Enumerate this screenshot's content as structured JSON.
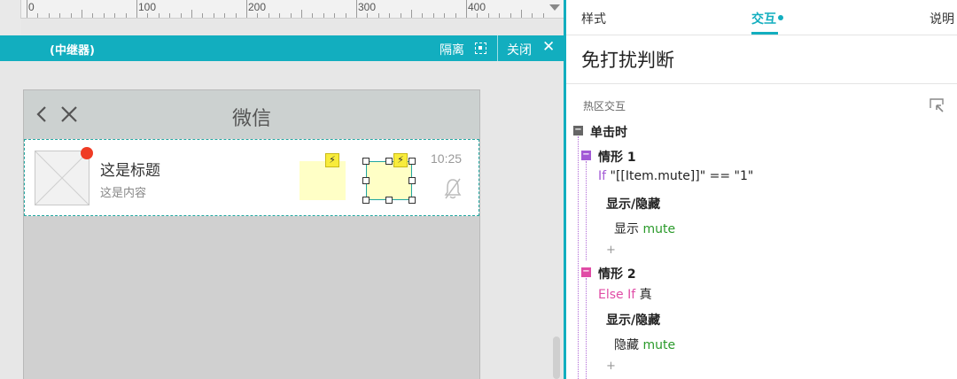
{
  "ruler": {
    "labels": [
      "0",
      "100",
      "200",
      "300",
      "400"
    ]
  },
  "repeater_bar": {
    "title": "(中继器)",
    "isolate_label": "隔离",
    "close_label": "关闭",
    "close_glyph": "✕"
  },
  "phone": {
    "title": "微信",
    "row": {
      "title": "这是标题",
      "content": "这是内容",
      "time": "10:25"
    },
    "bolt_glyph": "⚡"
  },
  "panel": {
    "tabs": {
      "style": "样式",
      "interaction": "交互",
      "notes": "说明"
    },
    "widget_name": "免打扰判断",
    "section_label": "热区交互",
    "event": {
      "box": "−",
      "label": "单击时"
    },
    "case1": {
      "box": "−",
      "label": "情形 1",
      "cond_keyword": "If",
      "cond_expr": " \"[[Item.mute]]\" == \"1\"",
      "action": "显示/隐藏",
      "verb": "显示",
      "target": "mute",
      "plus": "+"
    },
    "case2": {
      "box": "−",
      "label": "情形 2",
      "cond_keyword": "Else If",
      "cond_expr": " 真",
      "action": "显示/隐藏",
      "verb": "隐藏",
      "target": "mute",
      "plus": "+"
    }
  },
  "colors": {
    "accent": "#12aebf",
    "case1": "#a25ad6",
    "case2": "#e04ca6",
    "target": "#2a9a2a",
    "red_dot": "#ef3b24",
    "hotspot": "#ffffc6"
  }
}
